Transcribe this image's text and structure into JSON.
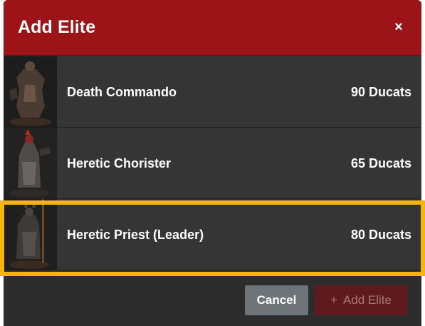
{
  "modal": {
    "title": "Add Elite",
    "close_label": "×",
    "items": [
      {
        "name": "Death Commando",
        "cost": "90 Ducats",
        "highlighted": false
      },
      {
        "name": "Heretic Chorister",
        "cost": "65 Ducats",
        "highlighted": false
      },
      {
        "name": "Heretic Priest (Leader)",
        "cost": "80 Ducats",
        "highlighted": true
      }
    ],
    "footer": {
      "cancel_label": "Cancel",
      "add_icon": "+",
      "add_label": "Add Elite"
    }
  },
  "colors": {
    "header": "#9c1418",
    "row_bg": "#353535",
    "highlight": "#f5b50a",
    "cancel_bg": "#6f7478",
    "add_bg": "#5f1a1d"
  }
}
